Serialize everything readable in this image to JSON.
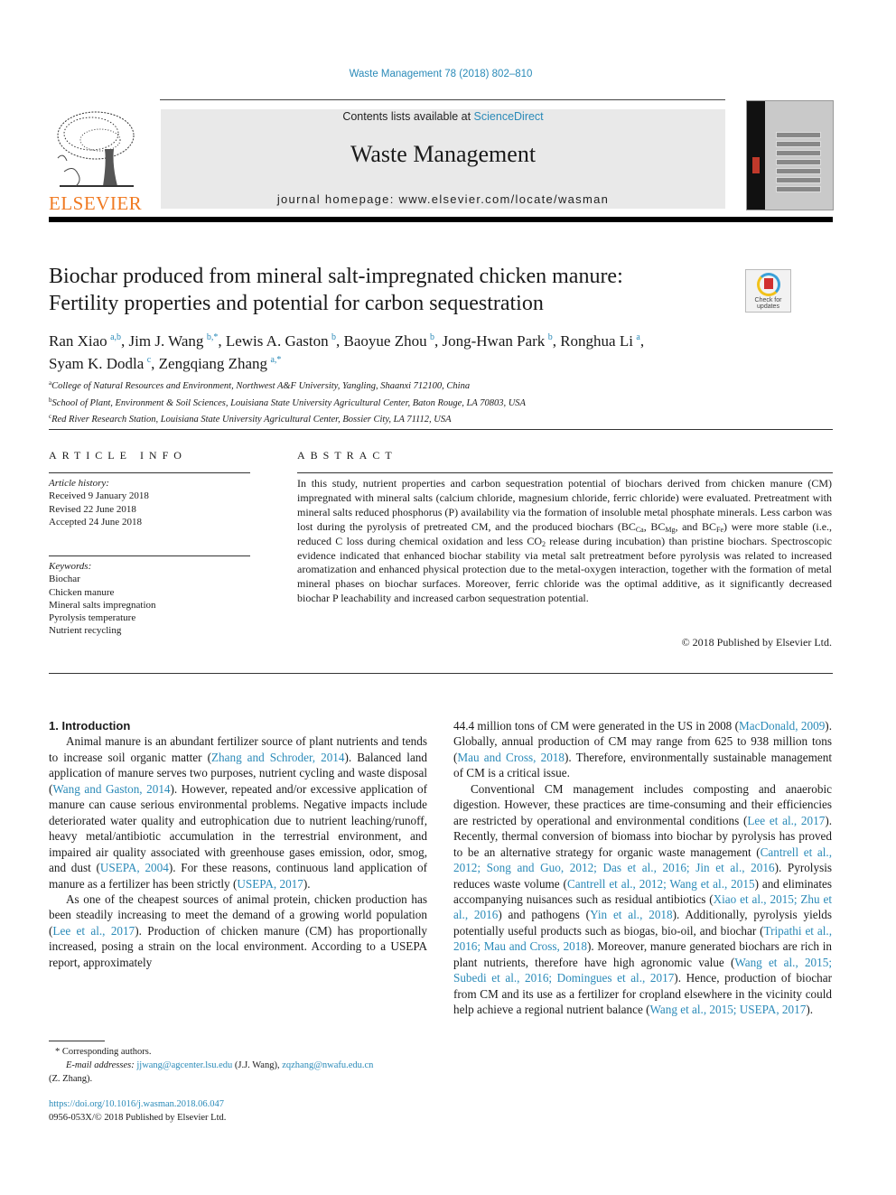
{
  "journal_ref": "Waste Management 78 (2018) 802–810",
  "header": {
    "publisher_logo": "ELSEVIER",
    "contents_prefix": "Contents lists available at ",
    "contents_link": "ScienceDirect",
    "journal_title": "Waste Management",
    "homepage": "journal homepage: www.elsevier.com/locate/wasman",
    "cover_icon": "journal-cover-image",
    "crossmark_label_1": "Check for",
    "crossmark_label_2": "updates"
  },
  "article": {
    "title_line1": "Biochar produced from mineral salt-impregnated chicken manure:",
    "title_line2": "Fertility properties and potential for carbon sequestration",
    "authors": [
      {
        "name": "Ran Xiao",
        "sup": "a,b",
        "sep": ", "
      },
      {
        "name": "Jim J. Wang",
        "sup": "b,*",
        "sep": ", "
      },
      {
        "name": "Lewis A. Gaston",
        "sup": "b",
        "sep": ", "
      },
      {
        "name": "Baoyue Zhou",
        "sup": "b",
        "sep": ", "
      },
      {
        "name": "Jong-Hwan Park",
        "sup": "b",
        "sep": ", "
      },
      {
        "name": "Ronghua Li",
        "sup": "a",
        "sep": ","
      },
      {
        "name": "Syam K. Dodla",
        "sup": "c",
        "sep": ", "
      },
      {
        "name": "Zengqiang Zhang",
        "sup": "a,*",
        "sep": ""
      }
    ],
    "affiliations": [
      {
        "key": "a",
        "text": "College of Natural Resources and Environment, Northwest A&F University, Yangling, Shaanxi 712100, China"
      },
      {
        "key": "b",
        "text": "School of Plant, Environment & Soil Sciences, Louisiana State University Agricultural Center, Baton Rouge, LA 70803, USA"
      },
      {
        "key": "c",
        "text": "Red River Research Station, Louisiana State University Agricultural Center, Bossier City, LA 71112, USA"
      }
    ]
  },
  "article_info": {
    "heading": "ARTICLE INFO",
    "history_label": "Article history:",
    "history": [
      "Received 9 January 2018",
      "Revised 22 June 2018",
      "Accepted 24 June 2018"
    ],
    "keywords_label": "Keywords:",
    "keywords": [
      "Biochar",
      "Chicken manure",
      "Mineral salts impregnation",
      "Pyrolysis temperature",
      "Nutrient recycling"
    ]
  },
  "abstract": {
    "heading": "ABSTRACT",
    "part1": "In this study, nutrient properties and carbon sequestration potential of biochars derived from chicken manure (CM) impregnated with mineral salts (calcium chloride, magnesium chloride, ferric chloride) were evaluated. Pretreatment with mineral salts reduced phosphorus (P) availability via the formation of insoluble metal phosphate minerals. Less carbon was lost during the pyrolysis of pretreated CM, and the produced biochars (",
    "bc": "BC",
    "sub_ca": "Ca",
    "sub_mg": "Mg",
    "sub_fe": "Fe",
    "sep1": ", ",
    "sep2": ", and ",
    "part2": ") were more stable (i.e., reduced C loss during chemical oxidation and less CO",
    "sub_2": "2",
    "part3": " release during incubation) than pristine biochars. Spectroscopic evidence indicated that enhanced biochar stability via metal salt pretreatment before pyrolysis was related to increased aromatization and enhanced physical protection due to the metal-oxygen interaction, together with the formation of metal mineral phases on biochar surfaces. Moreover, ferric chloride was the optimal additive, as it significantly decreased biochar P leachability and increased carbon sequestration potential.",
    "copyright": "© 2018 Published by Elsevier Ltd."
  },
  "intro": {
    "heading": "1. Introduction",
    "p1": [
      {
        "t": "Animal manure is an abundant fertilizer source of plant nutrients and tends to increase soil organic matter ("
      },
      {
        "l": "Zhang and Schroder, 2014"
      },
      {
        "t": "). Balanced land application of manure serves two purposes, nutrient cycling and waste disposal ("
      },
      {
        "l": "Wang and Gaston, 2014"
      },
      {
        "t": "). However, repeated and/or excessive application of manure can cause serious environmental problems. Negative impacts include deteriorated water quality and eutrophication due to nutrient leaching/runoff, heavy metal/antibiotic accumulation in the terrestrial environment, and impaired air quality associated with greenhouse gases emission, odor, smog, and dust ("
      },
      {
        "l": "USEPA, 2004"
      },
      {
        "t": "). For these reasons, continuous land application of manure as a fertilizer has been strictly ("
      },
      {
        "l": "USEPA, 2017"
      },
      {
        "t": ")."
      }
    ],
    "p2": [
      {
        "t": "As one of the cheapest sources of animal protein, chicken production has been steadily increasing to meet the demand of a growing world population ("
      },
      {
        "l": "Lee et al., 2017"
      },
      {
        "t": "). Production of chicken manure (CM) has proportionally increased, posing a strain on the local environment. According to a USEPA report, approximately"
      }
    ],
    "p2_cont": [
      {
        "t": "44.4 million tons of CM were generated in the US in 2008 ("
      },
      {
        "l": "MacDonald, 2009"
      },
      {
        "t": "). Globally, annual production of CM may range from 625 to 938 million tons ("
      },
      {
        "l": "Mau and Cross, 2018"
      },
      {
        "t": "). Therefore, environmentally sustainable management of CM is a critical issue."
      }
    ],
    "p3": [
      {
        "t": "Conventional CM management includes composting and anaerobic digestion. However, these practices are time-consuming and their efficiencies are restricted by operational and environmental conditions ("
      },
      {
        "l": "Lee et al., 2017"
      },
      {
        "t": "). Recently, thermal conversion of biomass into biochar by pyrolysis has proved to be an alternative strategy for organic waste management ("
      },
      {
        "l": "Cantrell et al., 2012; Song and Guo, 2012; Das et al., 2016; Jin et al., 2016"
      },
      {
        "t": "). Pyrolysis reduces waste volume ("
      },
      {
        "l": "Cantrell et al., 2012; Wang et al., 2015"
      },
      {
        "t": ") and eliminates accompanying nuisances such as residual antibiotics ("
      },
      {
        "l": "Xiao et al., 2015; Zhu et al., 2016"
      },
      {
        "t": ") and pathogens ("
      },
      {
        "l": "Yin et al., 2018"
      },
      {
        "t": "). Additionally, pyrolysis yields potentially useful products such as biogas, bio-oil, and biochar ("
      },
      {
        "l": "Tripathi et al., 2016; Mau and Cross, 2018"
      },
      {
        "t": "). Moreover, manure generated biochars are rich in plant nutrients, therefore have high agronomic value ("
      },
      {
        "l": "Wang et al., 2015; Subedi et al., 2016; Domingues et al., 2017"
      },
      {
        "t": "). Hence, production of biochar from CM and its use as a fertilizer for cropland elsewhere in the vicinity could help achieve a regional nutrient balance ("
      },
      {
        "l": "Wang et al., 2015; USEPA, 2017"
      },
      {
        "t": ")."
      }
    ]
  },
  "footnotes": {
    "corresponding": "* Corresponding authors.",
    "email_label": "E-mail addresses:",
    "email1": "jjwang@agcenter.lsu.edu",
    "email1_owner": " (J.J. Wang), ",
    "email2": "zqzhang@nwafu.edu.cn",
    "email2_owner": "(Z. Zhang).",
    "doi": "https://doi.org/10.1016/j.wasman.2018.06.047",
    "issn": "0956-053X/© 2018 Published by Elsevier Ltd."
  }
}
